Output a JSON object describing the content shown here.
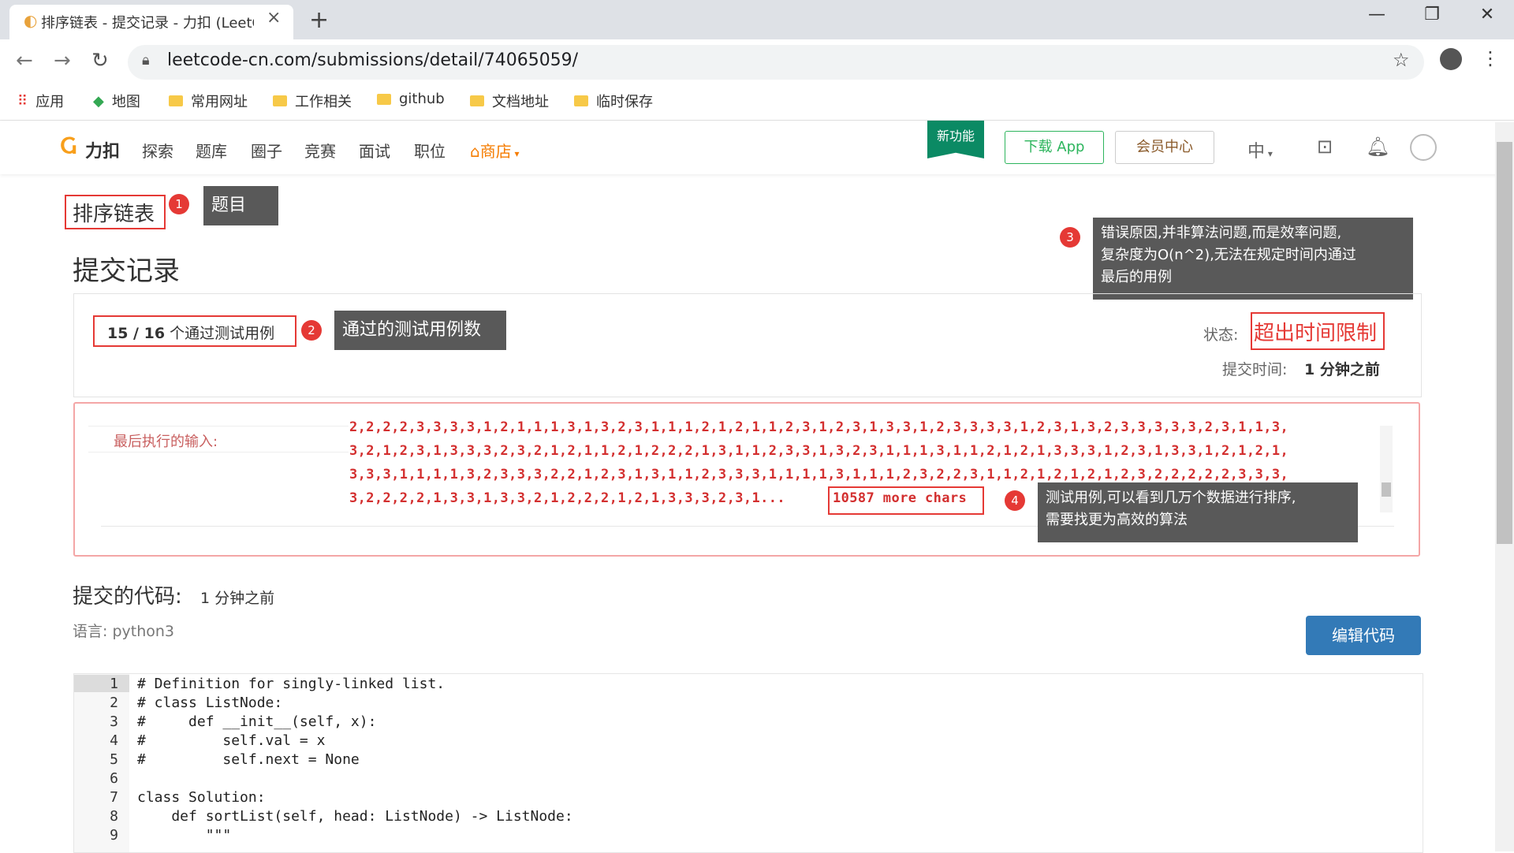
{
  "browser": {
    "tab_title": "排序链表 - 提交记录 - 力扣 (LeetCode)",
    "url": "leetcode-cn.com/submissions/detail/74065059/",
    "bookmarks": [
      "应用",
      "地图",
      "常用网址",
      "工作相关",
      "github",
      "文档地址",
      "临时保存"
    ]
  },
  "site": {
    "logo_text": "力扣",
    "nav": [
      "探索",
      "题库",
      "圈子",
      "竞赛",
      "面试",
      "职位"
    ],
    "store": "商店",
    "new_feature": "新功能",
    "download_app": "下载 App",
    "vip_center": "会员中心",
    "lang": "中"
  },
  "problem": {
    "title": "排序链表",
    "page_heading": "提交记录",
    "passed": "15 / 16",
    "passed_suffix": "个通过测试用例",
    "status_label": "状态:",
    "status": "超出时间限制",
    "submit_time_label": "提交时间:",
    "submit_time": "1 分钟之前",
    "last_input_label": "最后执行的输入:",
    "input_lines": [
      "2,2,2,2,3,3,3,3,1,2,1,1,1,3,1,3,2,3,1,1,1,2,1,2,1,1,2,3,1,2,3,1,3,3,1,2,3,3,3,3,1,2,3,1,3,2,3,3,3,3,3,2,3,1,1,3,",
      "3,2,1,2,3,1,3,3,3,2,3,2,1,2,1,1,2,1,2,2,2,1,3,1,1,2,3,3,1,3,2,3,1,1,1,3,1,1,2,1,2,1,3,3,3,1,2,3,1,3,3,1,2,1,2,1,",
      "3,3,3,1,1,1,1,3,2,3,3,3,2,2,1,2,3,1,3,1,1,2,3,3,3,1,1,1,1,3,1,1,1,2,3,2,2,3,1,1,2,1,2,1,2,1,2,3,2,2,2,2,2,3,3,3,",
      "3,2,2,2,2,1,3,3,1,3,3,2,1,2,2,2,1,2,1,3,3,3,2,3,1..."
    ],
    "more_chars": "10587 more chars",
    "code_label": "提交的代码:",
    "code_time": "1 分钟之前",
    "language": "语言: python3",
    "edit_button": "编辑代码"
  },
  "annotations": {
    "a1": "题目",
    "a2": "通过的测试用例数",
    "a3": "错误原因,并非算法问题,而是效率问题,复杂度为O(n^2),无法在规定时间内通过最后的用例",
    "a3_lines": [
      "错误原因,并非算法问题,而是效率问题,",
      "复杂度为O(n^2),无法在规定时间内通过",
      "最后的用例"
    ],
    "a4_lines": [
      "测试用例,可以看到几万个数据进行排序,",
      "需要找更为高效的算法"
    ],
    "n1": "1",
    "n2": "2",
    "n3": "3",
    "n4": "4"
  },
  "code": {
    "line_numbers": [
      "1",
      "2",
      "3",
      "4",
      "5",
      "6",
      "7",
      "8",
      "9"
    ],
    "lines": [
      "# Definition for singly-linked list.",
      "# class ListNode:",
      "#     def __init__(self, x):",
      "#         self.val = x",
      "#         self.next = None",
      "",
      "class Solution:",
      "    def sortList(self, head: ListNode) -> ListNode:",
      "        \"\"\""
    ]
  }
}
